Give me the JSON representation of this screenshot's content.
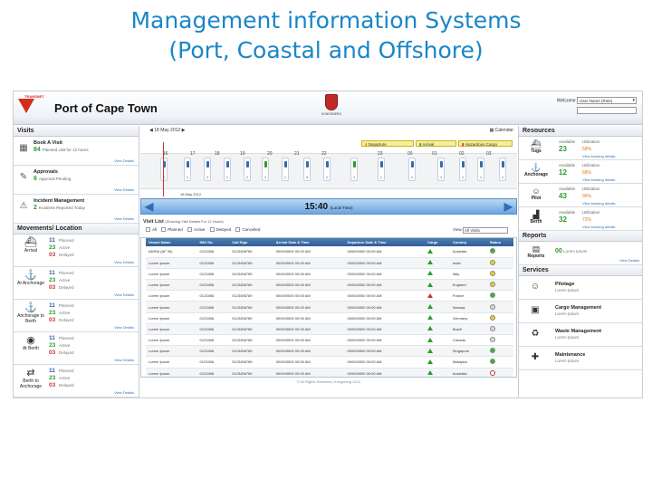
{
  "slide_title_line1": "Management information Systems",
  "slide_title_line2": "(Port, Coastal and Offshore)",
  "header": {
    "brand": "TRANSNET",
    "port_title": "Port of Cape Town",
    "kongsberg": "KONGSBERG",
    "welcome_label": "Welcome",
    "user_value": "User Name (Role)"
  },
  "visits": {
    "title": "Visits",
    "items": [
      {
        "title": "Book A Visit",
        "count": "84",
        "desc": "Planned visit for 12 hours",
        "link": "View Details"
      },
      {
        "title": "Approvals",
        "count": "6",
        "desc": "Approval Pending",
        "link": "View Details"
      },
      {
        "title": "Incident Management",
        "count": "2",
        "desc": "Incidents Reported Today",
        "link": "View Details"
      }
    ]
  },
  "movements": {
    "title": "Movements/ Location",
    "items": [
      {
        "label": "Arrival",
        "planned": "11",
        "active": "23",
        "delayed": "03",
        "link": "View Details"
      },
      {
        "label": "At Anchorage",
        "planned": "11",
        "active": "23",
        "delayed": "03",
        "link": "View Details"
      },
      {
        "label": "Anchorage to Berth",
        "planned": "11",
        "active": "23",
        "delayed": "03",
        "link": "View Details"
      },
      {
        "label": "At Berth",
        "planned": "11",
        "active": "23",
        "delayed": "03",
        "link": "View Details"
      },
      {
        "label": "Berth to Anchorage",
        "planned": "11",
        "active": "23",
        "delayed": "03",
        "link": "View Details"
      }
    ],
    "planned_label": "Planned",
    "active_label": "Active",
    "delayed_label": "Delayed"
  },
  "timeline": {
    "date": "18 May 2012",
    "calendar": "Calendar",
    "marker_date": "18 May 2012",
    "legend": {
      "departure": "Departure",
      "arrival": "Arrival",
      "hazardous": "Hazardous Cargo"
    },
    "hours": [
      "16",
      "17",
      "18",
      "19",
      "20",
      "21",
      "22",
      "23",
      "00",
      "01",
      "02",
      "03"
    ],
    "slots": [
      "1",
      "1",
      "2",
      "1",
      "2",
      "1",
      "1",
      "3",
      "1",
      "1",
      "1",
      "1",
      "1",
      "1",
      "1",
      "1"
    ],
    "clock": "15:40",
    "clock_sub": "(Local Time)"
  },
  "visit_list": {
    "title": "Visit List",
    "subtitle": "(Showing Visit Details For 12 Hours)",
    "filters": [
      "All",
      "Planned",
      "Active",
      "Delayed",
      "Cancelled"
    ],
    "view_label": "View",
    "view_value": "All Visits",
    "columns": [
      "Vessel Name",
      "IMO No.",
      "Call Sign",
      "Arrival Date & Time",
      "Departure Date & Time",
      "Cargo",
      "Country",
      "Status"
    ],
    "rows": [
      {
        "vessel": "ADRIA (AF 30)",
        "imo": "0123456",
        "call": "0123456789",
        "arr": "00/00/0000 00:00 AM",
        "dep": "00/00/0000 00:00 AM",
        "country": "Australia"
      },
      {
        "vessel": "Lorem Ipsum",
        "imo": "0123456",
        "call": "0123456789",
        "arr": "00/00/0000 00:00 AM",
        "dep": "00/00/0000 00:00 AM",
        "country": "India"
      },
      {
        "vessel": "Lorem Ipsum",
        "imo": "0123456",
        "call": "0123456789",
        "arr": "00/00/0000 00:00 AM",
        "dep": "00/00/0000 00:00 AM",
        "country": "Italy"
      },
      {
        "vessel": "Lorem Ipsum",
        "imo": "0123456",
        "call": "0123456789",
        "arr": "00/00/0000 00:00 AM",
        "dep": "00/00/0000 00:00 AM",
        "country": "England"
      },
      {
        "vessel": "Lorem Ipsum",
        "imo": "0123456",
        "call": "0123456789",
        "arr": "00/00/0000 00:00 AM",
        "dep": "00/00/0000 00:00 AM",
        "country": "France"
      },
      {
        "vessel": "Lorem Ipsum",
        "imo": "0123456",
        "call": "0123456789",
        "arr": "00/00/0000 00:00 AM",
        "dep": "00/00/0000 00:00 AM",
        "country": "Norway"
      },
      {
        "vessel": "Lorem Ipsum",
        "imo": "0123456",
        "call": "0123456789",
        "arr": "00/00/0000 00:00 AM",
        "dep": "00/00/0000 00:00 AM",
        "country": "Germany"
      },
      {
        "vessel": "Lorem Ipsum",
        "imo": "0123456",
        "call": "0123456789",
        "arr": "00/00/0000 00:00 AM",
        "dep": "00/00/0000 00:00 AM",
        "country": "Brazil"
      },
      {
        "vessel": "Lorem Ipsum",
        "imo": "0123456",
        "call": "0123456789",
        "arr": "00/00/0000 00:00 AM",
        "dep": "00/00/0000 00:00 AM",
        "country": "Canada"
      },
      {
        "vessel": "Lorem Ipsum",
        "imo": "0123456",
        "call": "0123456789",
        "arr": "00/00/0000 00:00 AM",
        "dep": "00/00/0000 00:00 AM",
        "country": "Singapore"
      },
      {
        "vessel": "Lorem Ipsum",
        "imo": "0123456",
        "call": "0123456789",
        "arr": "00/00/0000 00:00 AM",
        "dep": "00/00/0000 00:00 AM",
        "country": "Malaysia"
      },
      {
        "vessel": "Lorem Ipsum",
        "imo": "0123456",
        "call": "0123456789",
        "arr": "00/00/0000 00:00 AM",
        "dep": "00/00/0000 00:00 AM",
        "country": "Australia"
      }
    ],
    "footer": "© All Rights Reserved, Kongsberg 2012"
  },
  "resources": {
    "title": "Resources",
    "available_label": "Available",
    "utilization_label": "Utilization",
    "link": "View booking details",
    "items": [
      {
        "label": "Tugs",
        "available": "23",
        "util": "58%"
      },
      {
        "label": "Anchorage",
        "available": "12",
        "util": "68%"
      },
      {
        "label": "Pilot",
        "available": "43",
        "util": "96%"
      },
      {
        "label": "Berth",
        "available": "32",
        "util": "72%"
      }
    ]
  },
  "reports": {
    "title": "Reports",
    "label": "Reports",
    "count": "00",
    "desc": "Lorem Ipsum",
    "link": "View Details"
  },
  "services": {
    "title": "Services",
    "items": [
      {
        "title": "Pilotage",
        "desc": "Lorem Ipsum"
      },
      {
        "title": "Cargo Management",
        "desc": "Lorem Ipsum"
      },
      {
        "title": "Waste Management",
        "desc": "Lorem Ipsum"
      },
      {
        "title": "Maintenance",
        "desc": "Lorem Ipsum"
      }
    ]
  }
}
